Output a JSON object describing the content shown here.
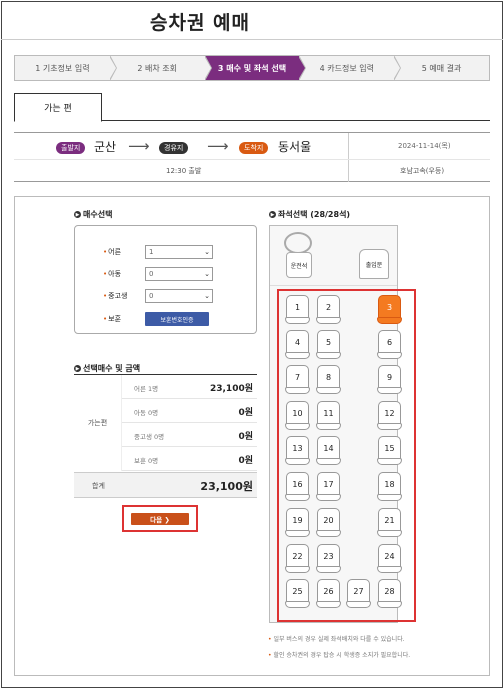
{
  "page": {
    "title": "승차권 예매"
  },
  "steps": [
    {
      "label": "1 기초정보 입력",
      "active": false
    },
    {
      "label": "2 배차 조회",
      "active": false
    },
    {
      "label": "3 매수 및 좌석 선택",
      "active": true
    },
    {
      "label": "4 카드정보 입력",
      "active": false
    },
    {
      "label": "5 예매 결과",
      "active": false
    }
  ],
  "tab": {
    "label": "가는 편"
  },
  "route": {
    "departure_badge": "출발지",
    "departure": "군산",
    "via_badge": "경유지",
    "arrival_badge": "도착지",
    "arrival": "동서울",
    "arrow": "⟶",
    "date": "2024-11-14(목)",
    "time": "12:30 출발",
    "company": "호남고속(우등)"
  },
  "count_section": {
    "title": "매수선택",
    "rows": [
      {
        "label": "어른",
        "value": "1",
        "type": "select"
      },
      {
        "label": "아동",
        "value": "0",
        "type": "select"
      },
      {
        "label": "중고생",
        "value": "0",
        "type": "select"
      },
      {
        "label": "보훈",
        "button": "보훈번호인증",
        "type": "button"
      }
    ]
  },
  "amount_section": {
    "title": "선택매수 및 금액",
    "direction": "가는편",
    "rows": [
      {
        "label": "어른 1명",
        "value": "23,100원"
      },
      {
        "label": "아동 0명",
        "value": "0원"
      },
      {
        "label": "중고생 0명",
        "value": "0원"
      },
      {
        "label": "보훈 0명",
        "value": "0원"
      }
    ],
    "total_label": "합계",
    "total_value": "23,100원"
  },
  "next_button": {
    "label": "다음 ❯"
  },
  "seat_section": {
    "title": "좌석선택 (28/28석)",
    "driver": "운전석",
    "door": "출입문",
    "selected_seat": "3",
    "seats": [
      "1",
      "2",
      "3",
      "4",
      "5",
      "6",
      "7",
      "8",
      "9",
      "10",
      "11",
      "12",
      "13",
      "14",
      "15",
      "16",
      "17",
      "18",
      "19",
      "20",
      "21",
      "22",
      "23",
      "24",
      "25",
      "26",
      "27",
      "28"
    ]
  },
  "notes": [
    "일부 버스의 경우 실제 좌석배치와 다를 수 있습니다.",
    "할인 승차권의 경우 탑승 시 학생증 소지가 필요합니다."
  ],
  "colors": {
    "accent": "#7b2d7f",
    "orange": "#f47a20",
    "highlight": "#dd3333",
    "button_blue": "#3d5ba6"
  }
}
